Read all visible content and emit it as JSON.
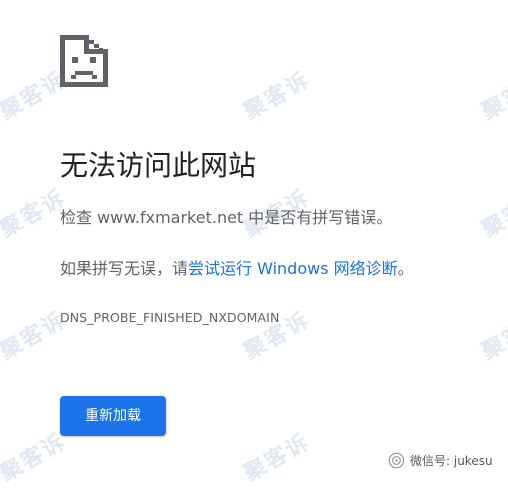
{
  "error_page": {
    "title": "无法访问此网站",
    "check": {
      "prefix": "检查 ",
      "domain": "www.fxmarket.net",
      "suffix": " 中是否有拼写错误。"
    },
    "suggestion": {
      "prefix": "如果拼写无误，请",
      "link": "尝试运行 Windows 网络诊断",
      "suffix": "。"
    },
    "error_code": "DNS_PROBE_FINISHED_NXDOMAIN",
    "reload_button": "重新加载"
  },
  "watermark": {
    "text": "聚客诉"
  },
  "footer": {
    "wechat_label": "微信号: jukesu"
  },
  "colors": {
    "primary": "#1a73e8",
    "title": "#202124",
    "body_text": "#5f6368",
    "icon": "#5f6368"
  },
  "icons": {
    "error": "sad-page-icon",
    "wechat": "wechat-icon"
  }
}
